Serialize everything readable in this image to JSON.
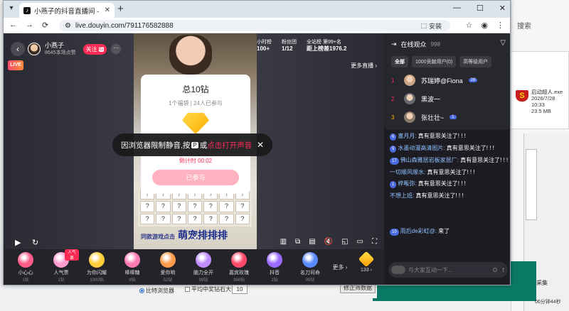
{
  "desktop": {
    "search_label": "搜索",
    "file": {
      "name": "启动超人.exe",
      "date": "2026/7/28 10:33",
      "size": "23.5 MB"
    },
    "result_label": "结果采集",
    "bottom_label": "06分钟44秒"
  },
  "tool_strip": {
    "radio_label": "比特浏览器",
    "check_label": "平均中奖钻石大于",
    "value": "10",
    "button_label": "修正筛数据"
  },
  "browser": {
    "tab_title": "小燕子的抖音直播间 - 抖音直播",
    "url": "live.douyin.com/791176582888",
    "install_label": "安装"
  },
  "live": {
    "anchor_name": "小燕子",
    "likes": "8645本场点赞",
    "follow_label": "关注",
    "follow_key": "G",
    "live_badge": "LIVE",
    "rank": [
      {
        "label": "小时榜",
        "value": "100+"
      },
      {
        "label": "粉丝团",
        "value": "1/12"
      },
      {
        "label": "全站榜 第99+名",
        "value": "距上榜差1976.2"
      }
    ],
    "more_live": "更多直播",
    "card": {
      "title": "总10钻",
      "subtitle": "1个福袋 | 24人已参与",
      "timer": "倒计时 00:02",
      "button": "已参与"
    },
    "toast": {
      "text_before": "因浏览器限制静音,按",
      "key": "P",
      "text_mid": "或",
      "link": "点击打开声音"
    },
    "video_toys": [
      "?",
      "?",
      "?",
      "?",
      "?",
      "?",
      "?",
      "?",
      "?",
      "?",
      "?",
      "?",
      "?",
      "?",
      "?",
      "?",
      "?",
      "?",
      "?",
      "?",
      "?"
    ],
    "brand_prefix": "同款游戏点击",
    "brand_name": "萌宠排排排"
  },
  "gifts": [
    {
      "name": "小心心",
      "price": "1钻",
      "color": "#ff5c8a",
      "tag": ""
    },
    {
      "name": "人气票",
      "price": "1钻",
      "color": "#ff9ad1",
      "tag": "人气票"
    },
    {
      "name": "为你闪耀",
      "price": "1000钻",
      "color": "#ffcf3a",
      "tag": ""
    },
    {
      "name": "棒棒糖",
      "price": "9钻",
      "color": "#ff7ab3",
      "tag": ""
    },
    {
      "name": "爱你哟",
      "price": "52钻",
      "color": "#ff9c4a",
      "tag": ""
    },
    {
      "name": "脑力全开",
      "price": "99钻",
      "color": "#c08cff",
      "tag": ""
    },
    {
      "name": "嘉宾玫瑰",
      "price": "366钻",
      "color": "#ff4a6a",
      "tag": ""
    },
    {
      "name": "抖音",
      "price": "1钻",
      "color": "#9b6bff",
      "tag": ""
    },
    {
      "name": "名刀司命",
      "price": "99钻",
      "color": "#5a8bff",
      "tag": ""
    }
  ],
  "gift_more": "更多",
  "diamond_count": "133",
  "audience": {
    "title": "在线观众",
    "count": "998",
    "tabs": [
      "全部",
      "1000贡献用户(0)",
      "高等级用户"
    ],
    "rows": [
      {
        "rank": "1",
        "name": "苏瑞婷@Fiona",
        "level": "28"
      },
      {
        "rank": "2",
        "name": "黑波一",
        "level": ""
      },
      {
        "rank": "3",
        "name": "张壮壮~",
        "level": "1"
      }
    ]
  },
  "chat": [
    {
      "badge": "6",
      "name": "塞月月",
      "text": "真有意思关注了! ! !"
    },
    {
      "badge": "9",
      "name": "水墨动漫高清图片",
      "text": "真有意思关注了! ! !"
    },
    {
      "badge": "17",
      "name": "佛山森雅居岩板家居厂",
      "text": "真有意思关注了! ! !"
    },
    {
      "badge": "",
      "name": "一切顺风顺水",
      "text": "真有意思关注了! ! !"
    },
    {
      "badge": "1",
      "name": "梓畈弥",
      "text": "真有意思关注了! ! !"
    },
    {
      "badge": "",
      "name": "不想上班",
      "text": "真有意思关注了! ! !"
    },
    {
      "badge": "10",
      "name": "雨后de彩虹@",
      "text": "来了"
    }
  ],
  "chat_placeholder": "与大家互动一下..."
}
